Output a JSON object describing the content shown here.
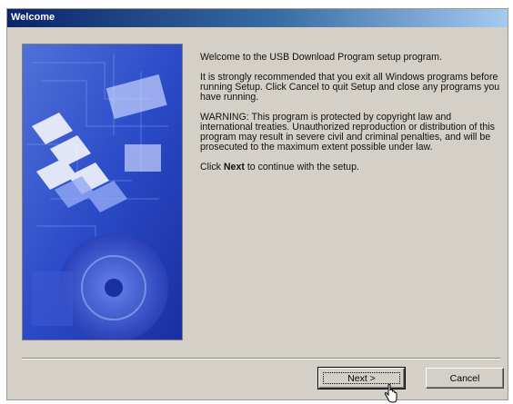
{
  "window": {
    "title": "Welcome"
  },
  "content": {
    "para1": "Welcome to the USB Download Program setup program.",
    "para2": "It is strongly recommended that you exit all Windows programs before running Setup.  Click Cancel to quit Setup and close any programs you have running.",
    "para3": "WARNING:  This program is protected by copyright law and international treaties.  Unauthorized reproduction or distribution of this program may result in severe civil and criminal penalties, and will be prosecuted to the maximum extent possible under law.",
    "para4_prefix": "Click ",
    "para4_bold": "Next",
    "para4_suffix": " to continue with the setup."
  },
  "buttons": {
    "next_label": "Next >",
    "cancel_label": "Cancel"
  },
  "icons": {
    "cursor": "pointer-hand-icon"
  },
  "colors": {
    "titlebar_start": "#0a246a",
    "titlebar_end": "#a6caf0",
    "dialog_bg": "#d4d0c8",
    "hero_blue": "#3a5bd6"
  }
}
